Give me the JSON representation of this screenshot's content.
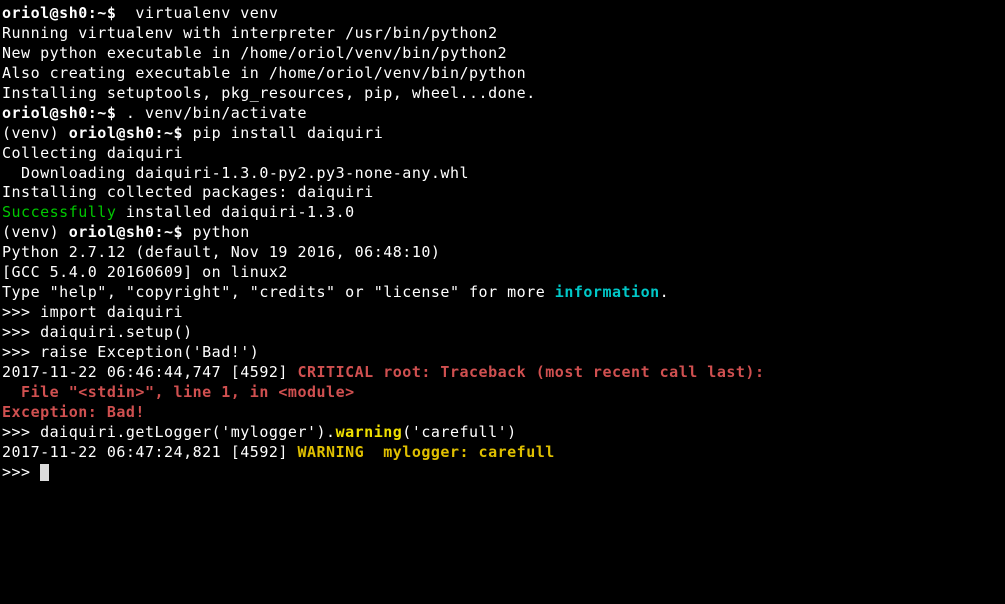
{
  "lines": {
    "l01_prompt": "oriol@sh0",
    "l01_path": ":~$",
    "l01_cmd": "  virtualenv venv",
    "l02": "Running virtualenv with interpreter /usr/bin/python2",
    "l03": "New python executable in /home/oriol/venv/bin/python2",
    "l04": "Also creating executable in /home/oriol/venv/bin/python",
    "l05": "Installing setuptools, pkg_resources, pip, wheel...done.",
    "l06_prompt": "oriol@sh0",
    "l06_path": ":~$",
    "l06_cmd": " . venv/bin/activate",
    "l07_venv": "(venv) ",
    "l07_prompt": "oriol@sh0",
    "l07_path": ":~$",
    "l07_cmd": " pip install daiquiri",
    "l08": "Collecting daiquiri",
    "l09": "  Downloading daiquiri-1.3.0-py2.py3-none-any.whl",
    "l10": "Installing collected packages: daiquiri",
    "l11a": "Successfully",
    "l11b": " installed daiquiri-1.3.0",
    "l12_venv": "(venv) ",
    "l12_prompt": "oriol@sh0",
    "l12_path": ":~$",
    "l12_cmd": " python",
    "l13": "Python 2.7.12 (default, Nov 19 2016, 06:48:10)",
    "l14": "[GCC 5.4.0 20160609] on linux2",
    "l15a": "Type \"help\", \"copyright\", \"credits\" or \"license\" for more ",
    "l15b": "information",
    "l15c": ".",
    "l16": ">>> import daiquiri",
    "l17": ">>> daiquiri.setup()",
    "l18": ">>> raise Exception('Bad!')",
    "l19a": "2017-11-22 06:46:44,747 [4592] ",
    "l19b": "CRITICAL root: Traceback (most recent call last):",
    "l20": "  File \"<stdin>\", line 1, in <module>",
    "l21": "Exception: Bad!",
    "l22": "",
    "l23a": ">>> daiquiri.getLogger('mylogger').",
    "l23b": "warning",
    "l23c": "('carefull')",
    "l24a": "2017-11-22 06:47:24,821 [4592] ",
    "l24b": "WARNING  mylogger: carefull",
    "l25": ">>> "
  }
}
